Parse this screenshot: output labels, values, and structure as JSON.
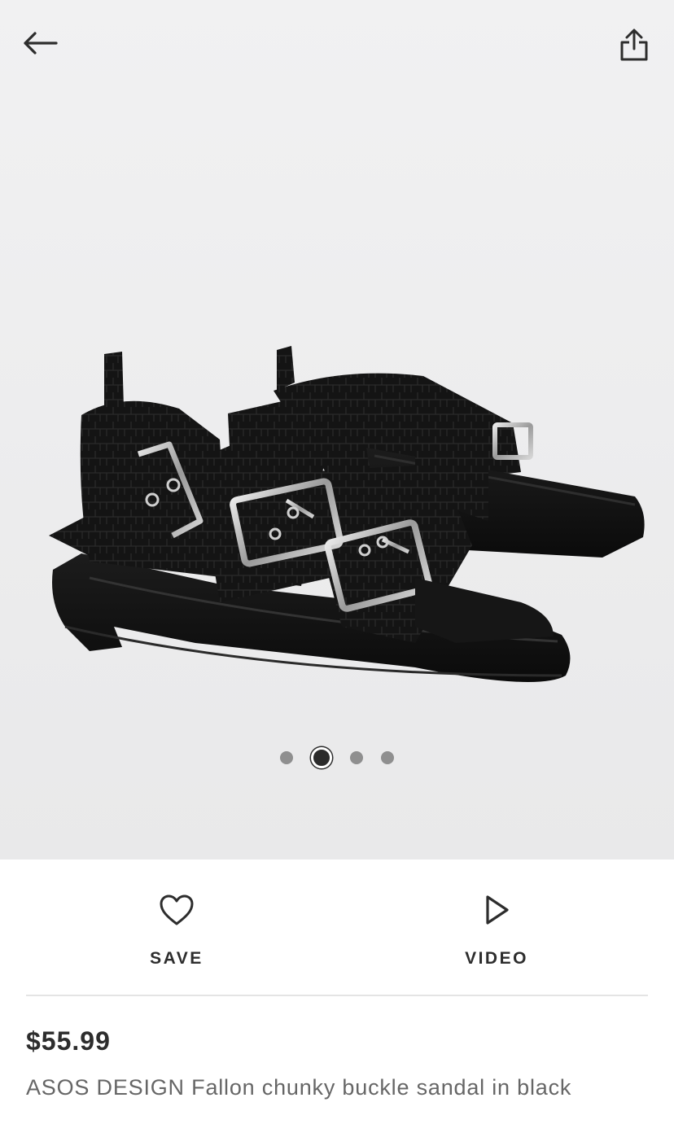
{
  "header": {
    "back_icon": "arrow-left-icon",
    "share_icon": "share-icon"
  },
  "gallery": {
    "image_alt": "ASOS DESIGN Fallon chunky buckle sandal in black",
    "dots_count": 4,
    "active_dot_index": 1
  },
  "actions": {
    "save_label": "SAVE",
    "save_icon": "heart-icon",
    "video_label": "VIDEO",
    "video_icon": "play-icon"
  },
  "product": {
    "price": "$55.99",
    "title": "ASOS DESIGN Fallon chunky buckle sandal in black"
  },
  "colors": {
    "text_dark": "#2d2d2d",
    "text_muted": "#666666",
    "gallery_bg": "#eeeeef"
  }
}
